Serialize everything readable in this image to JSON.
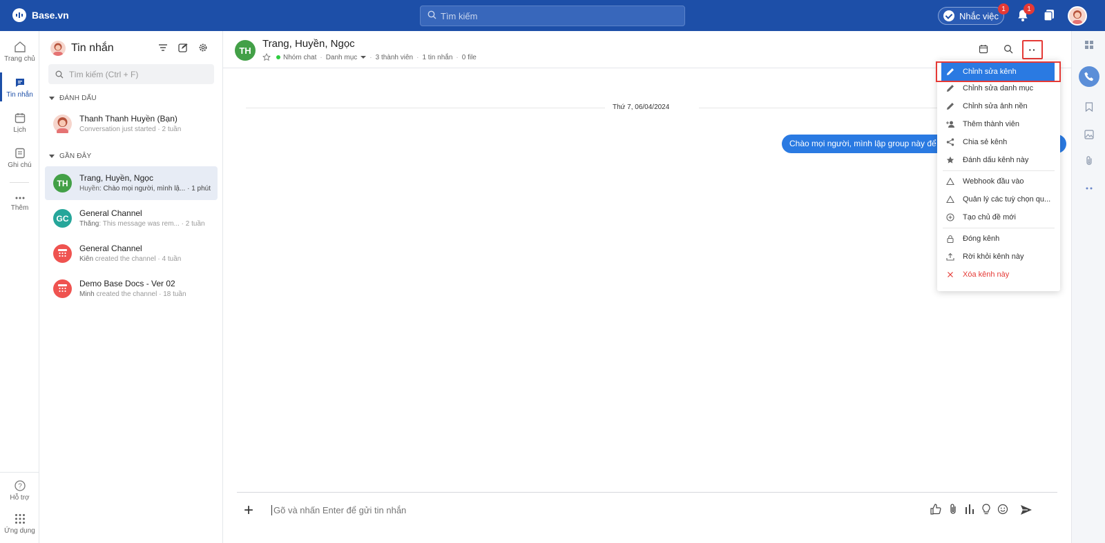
{
  "colors": {
    "topbar": "#1d4fa8",
    "accent": "#2a7ae2",
    "danger": "#e53935",
    "online": "#2ecc40"
  },
  "brand": {
    "name": "Base.vn"
  },
  "topbar": {
    "search_placeholder": "Tìm kiếm",
    "remind_label": "Nhắc việc",
    "remind_badge": "1",
    "notif_badge": "1"
  },
  "rail": {
    "items": [
      {
        "label": "Trang chủ",
        "icon": "home-icon"
      },
      {
        "label": "Tin nhắn",
        "icon": "message-icon"
      },
      {
        "label": "Lịch",
        "icon": "calendar-icon"
      },
      {
        "label": "Ghi chú",
        "icon": "note-icon"
      },
      {
        "label": "Thêm",
        "icon": "more-icon"
      }
    ],
    "bottom": [
      {
        "label": "Hỗ trợ",
        "icon": "help-icon"
      },
      {
        "label": "Ứng dụng",
        "icon": "apps-icon"
      }
    ]
  },
  "convs": {
    "title": "Tin nhắn",
    "search_placeholder": "Tìm kiếm (Ctrl + F)",
    "section_marked": "ĐÁNH DẤU",
    "section_recent": "GẦN ĐÂY",
    "marked": [
      {
        "name": "Thanh Thanh Huyền (Bạn)",
        "preview": "Conversation just started · 2 tuần"
      }
    ],
    "recent": [
      {
        "initials": "TH",
        "name": "Trang, Huyền, Ngọc",
        "sender": "Huyền",
        "preview": ": Chào mọi người, mình lậ...  · 1 phút",
        "color": "#43a047"
      },
      {
        "initials": "GC",
        "name": "General Channel",
        "sender": "Thắng",
        "preview": ": This message was rem...  · 2 tuần",
        "color": "#26a69a"
      },
      {
        "initials": "",
        "name": "General Channel",
        "sender": "Kiên",
        "preview": " created the channel · 4 tuần",
        "color": "#ef5350"
      },
      {
        "initials": "",
        "name": "Demo Base Docs - Ver 02",
        "sender": "Minh",
        "preview": " created the channel · 18 tuần",
        "color": "#ef5350"
      }
    ]
  },
  "chat": {
    "initials": "TH",
    "title": "Trang, Huyền, Ngọc",
    "type": "Nhóm chat",
    "category": "Danh mục",
    "members": "3 thành viên",
    "messages": "1 tin nhắn",
    "files": "0 file",
    "more_label": "··",
    "date": "Thứ 7, 06/04/2024",
    "bubble": "Chào mọi người, mình lập group này để tra",
    "composer_placeholder": "Gõ và nhấn Enter để gửi tin nhắn"
  },
  "menu": {
    "items": [
      {
        "label": "Chỉnh sửa kênh",
        "icon": "pencil-icon"
      },
      {
        "label": "Chỉnh sửa danh mục",
        "icon": "pencil-icon"
      },
      {
        "label": "Chỉnh sửa ảnh nền",
        "icon": "pencil-icon"
      },
      {
        "label": "Thêm thành viên",
        "icon": "add-user-icon"
      },
      {
        "label": "Chia sẻ kênh",
        "icon": "share-icon"
      },
      {
        "label": "Đánh dấu kênh này",
        "icon": "star-icon"
      },
      {
        "label": "Webhook đầu vào",
        "icon": "webhook-icon"
      },
      {
        "label": "Quản lý các tuỳ chọn qu...",
        "icon": "webhook-icon"
      },
      {
        "label": "Tạo chủ đề mới",
        "icon": "plus-circle-icon"
      },
      {
        "label": "Đóng kênh",
        "icon": "lock-icon"
      },
      {
        "label": "Rời khỏi kênh này",
        "icon": "upload-icon"
      },
      {
        "label": "Xóa kênh này",
        "icon": "close-icon"
      }
    ]
  }
}
